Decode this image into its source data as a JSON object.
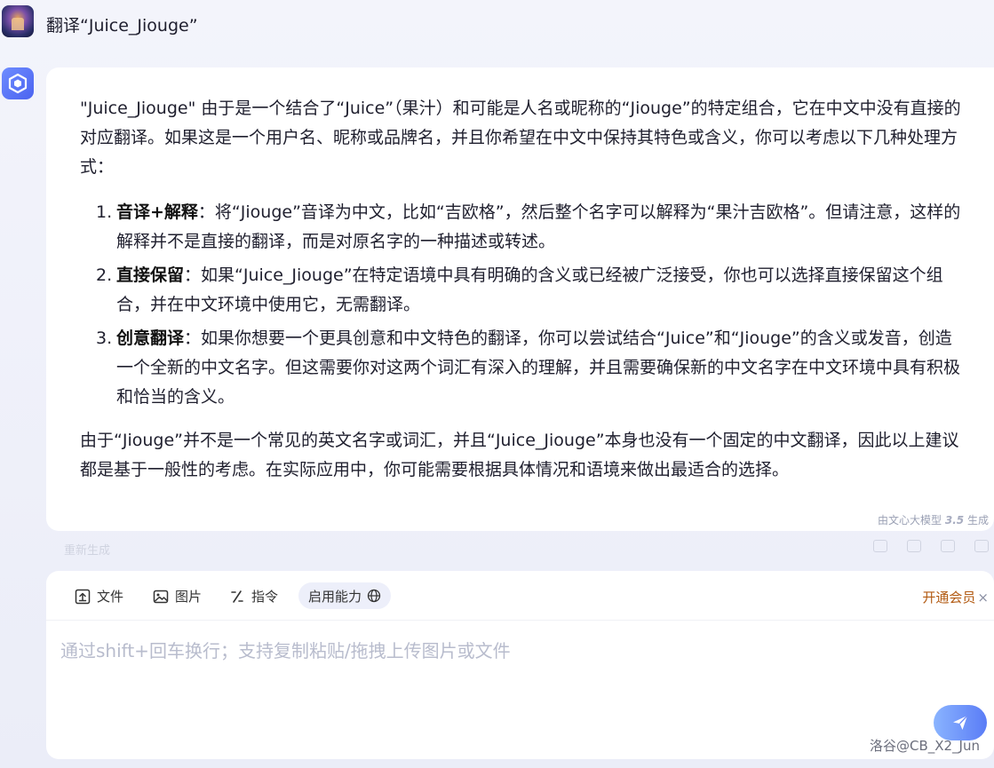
{
  "user_message": {
    "text": "翻译“Juice_Jiouge”"
  },
  "answer": {
    "intro": "\"Juice_Jiouge\" 由于是一个结合了“Juice”（果汁）和可能是人名或昵称的“Jiouge”的特定组合，它在中文中没有直接的对应翻译。如果这是一个用户名、昵称或品牌名，并且你希望在中文中保持其特色或含义，你可以考虑以下几种处理方式：",
    "items": [
      {
        "num": "1.",
        "title": "音译+解释",
        "text": "：将“Jiouge”音译为中文，比如“吉欧格”，然后整个名字可以解释为“果汁吉欧格”。但请注意，这样的解释并不是直接的翻译，而是对原名字的一种描述或转述。"
      },
      {
        "num": "2.",
        "title": "直接保留",
        "text": "：如果“Juice_Jiouge”在特定语境中具有明确的含义或已经被广泛接受，你也可以选择直接保留这个组合，并在中文环境中使用它，无需翻译。"
      },
      {
        "num": "3.",
        "title": "创意翻译",
        "text": "：如果你想要一个更具创意和中文特色的翻译，你可以尝试结合“Juice”和“Jiouge”的含义或发音，创造一个全新的中文名字。但这需要你对这两个词汇有深入的理解，并且需要确保新的中文名字在中文环境中具有积极和恰当的含义。"
      }
    ],
    "closing": "由于“Jiouge”并不是一个常见的英文名字或词汇，并且“Juice_Jiouge”本身也没有一个固定的中文翻译，因此以上建议都是基于一般性的考虑。在实际应用中，你可能需要根据具体情况和语境来做出最适合的选择。",
    "generated_by_prefix": "由文心大模型",
    "generated_by_version": "3.5",
    "generated_by_suffix": "生成"
  },
  "actions": {
    "regenerate_label": "重新生成"
  },
  "input_panel": {
    "tools": {
      "file_label": "文件",
      "image_label": "图片",
      "command_label": "指令",
      "enable_label": "启用能力"
    },
    "member_label": "开通会员",
    "member_close": "×",
    "placeholder": "通过shift+回车换行；支持复制粘贴/拖拽上传图片或文件",
    "value": ""
  },
  "watermark": "洛谷@CB_X2_Jun",
  "colors": {
    "accent": "#4b63f0",
    "send_gradient_start": "#8ab4ff",
    "send_gradient_end": "#5a7cf6",
    "member": "#b25a12",
    "background": "#eef0f8"
  },
  "icons": {
    "user_avatar": "user-avatar-image",
    "bot_avatar": "ernie-bot-logo-icon",
    "file": "upload-file-icon",
    "image": "image-icon",
    "command": "slash-command-icon",
    "enable": "globe-icon",
    "send": "paper-plane-icon"
  }
}
